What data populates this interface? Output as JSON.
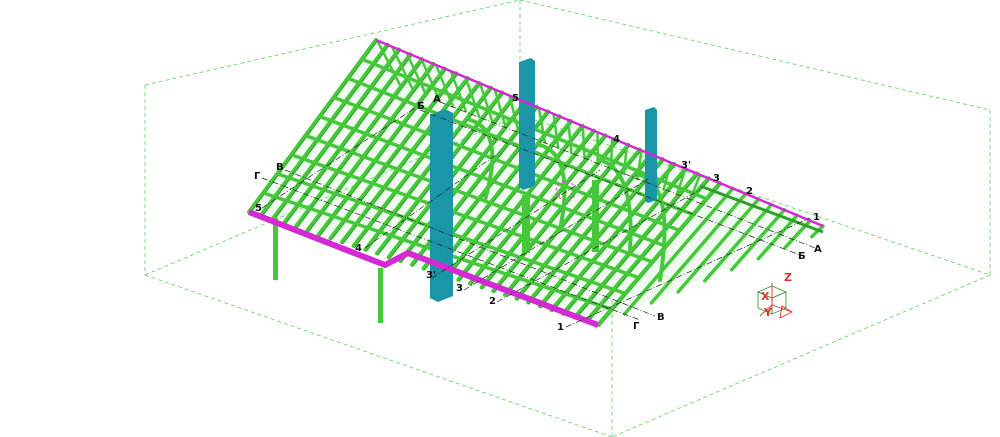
{
  "colors": {
    "background": "#ffffff",
    "bounding_box": "#5ed35e",
    "frame": "#45c83a",
    "frame_dark": "#2f9e2a",
    "eave_beam": "#d429d4",
    "ridge": "#d429d4",
    "column": "#1b95a8",
    "grid_line": "#222222",
    "marker_circle": "#e05ad6",
    "axis_z": "#e03030",
    "axis_x": "#e03030",
    "axis_y": "#e03030",
    "axis_cube": "#3c9a3c"
  },
  "grid_labels": {
    "left_row_Г": "Г",
    "left_row_В": "В",
    "left_row_Б": "Б",
    "left_row_А": "А",
    "left_col_5": "5",
    "left_col_4": "4",
    "left_col_3p": "3'",
    "left_col_3": "3",
    "left_col_2": "2",
    "left_col_1": "1",
    "right_row_Г": "Г",
    "right_row_В": "В",
    "right_row_Б": "Б",
    "right_row_А": "А",
    "ridge_5": "5",
    "ridge_4": "4",
    "ridge_3p": "3'",
    "ridge_3": "3",
    "ridge_2": "2",
    "ridge_1": "1"
  },
  "axes": {
    "z_label": "Z",
    "x_label": "X",
    "y_label": "Y"
  }
}
